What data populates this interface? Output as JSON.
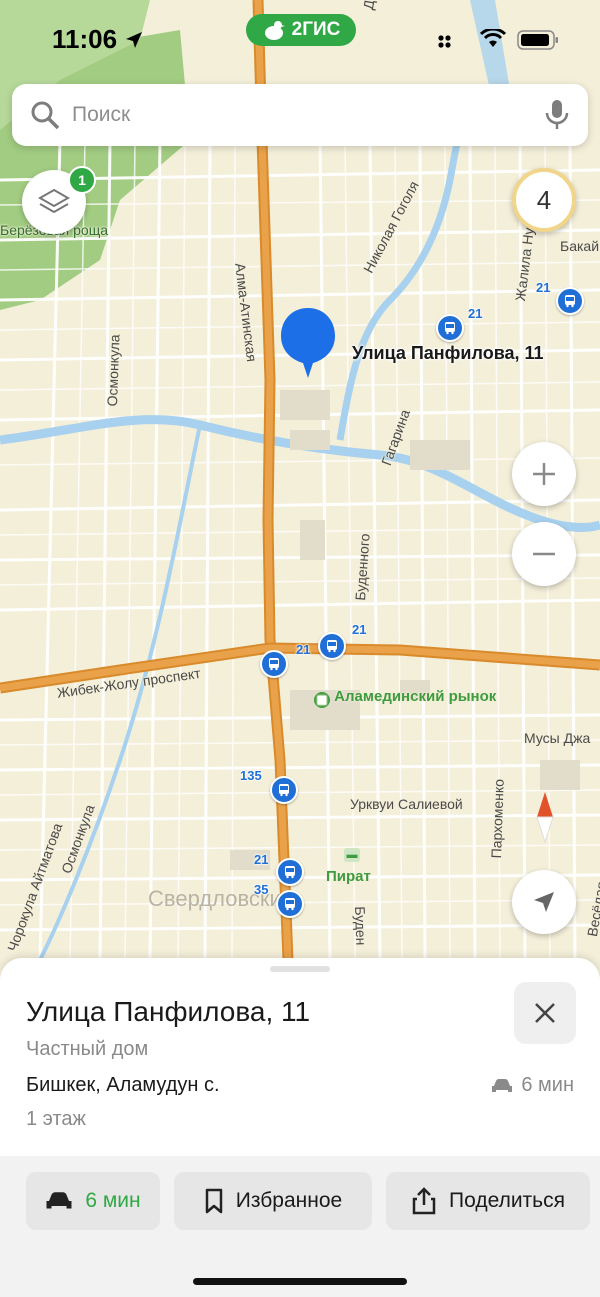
{
  "status_bar": {
    "time": "11:06",
    "brand": "2ГИС"
  },
  "search": {
    "placeholder": "Поиск"
  },
  "map": {
    "layers_badge": "1",
    "traffic_score": "4",
    "selected_label": "Улица Панфилова, 11",
    "district": "Свердловский",
    "streets": [
      "Достук",
      "Алма-Атинская",
      "Николая Гоголя",
      "Жалила Нургаз",
      "Бакай",
      "Осмонкула",
      "Гагарина",
      "Буденного",
      "Жибек-Жолу проспект",
      "Мусы Джа",
      "Урквуи Салиевой",
      "Пархоменко",
      "Осмонкула",
      "Чорокула Айтматова",
      "Весёлая",
      "Буден",
      "Берёзовая роща"
    ],
    "pois": {
      "market": "Аламединский рынок",
      "hotel": "Пират"
    },
    "bus_routes": {
      "r1": "21",
      "r2": "21",
      "r3": "21",
      "r4": "21",
      "r5": "135",
      "r6": "21",
      "r7": "35"
    }
  },
  "sheet": {
    "title": "Улица Панфилова, 11",
    "subtitle": "Частный дом",
    "address": "Бишкек, Аламудун с.",
    "eta": "6 мин",
    "floors": "1 этаж",
    "actions": {
      "route": "6 мин",
      "favorite": "Избранное",
      "share": "Поделиться"
    }
  },
  "colors": {
    "accent": "#2fa845",
    "pin": "#1d6fe8",
    "bus": "#1f6fd6",
    "road_major": "#e49a3c",
    "river": "#a7d1ee",
    "park": "#93c572"
  }
}
